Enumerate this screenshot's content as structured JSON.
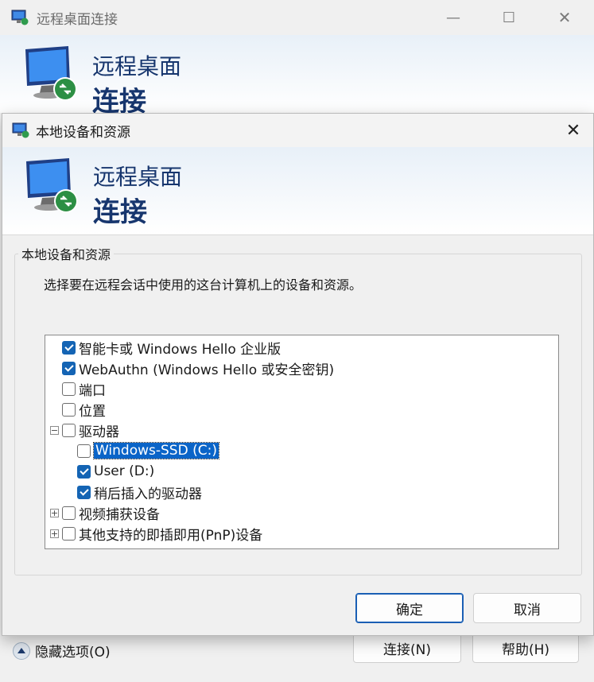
{
  "main_window": {
    "title": "远程桌面连接",
    "minimize_glyph": "—",
    "maximize_glyph": "☐",
    "close_glyph": "✕",
    "banner_line1": "远程桌面",
    "banner_line2": "连接",
    "options_toggle_label": "隐藏选项(O)",
    "connect_label": "连接(N)",
    "help_label": "帮助(H)"
  },
  "dialog": {
    "title": "本地设备和资源",
    "close_glyph": "✕",
    "banner_line1": "远程桌面",
    "banner_line2": "连接",
    "group_title": "本地设备和资源",
    "description": "选择要在远程会话中使用的这台计算机上的设备和资源。",
    "tree": [
      {
        "label": "智能卡或 Windows Hello 企业版",
        "checked": true,
        "level": 0,
        "expander": ""
      },
      {
        "label": "WebAuthn (Windows Hello 或安全密钥)",
        "checked": true,
        "level": 0,
        "expander": ""
      },
      {
        "label": "端口",
        "checked": false,
        "level": 0,
        "expander": ""
      },
      {
        "label": "位置",
        "checked": false,
        "level": 0,
        "expander": ""
      },
      {
        "label": "驱动器",
        "checked": false,
        "level": 0,
        "expander": "−"
      },
      {
        "label": "Windows-SSD (C:)",
        "checked": false,
        "level": 1,
        "expander": "",
        "selected": true
      },
      {
        "label": "User (D:)",
        "checked": true,
        "level": 1,
        "expander": ""
      },
      {
        "label": "稍后插入的驱动器",
        "checked": true,
        "level": 1,
        "expander": ""
      },
      {
        "label": "视频捕获设备",
        "checked": false,
        "level": 0,
        "expander": "+"
      },
      {
        "label": "其他支持的即插即用(PnP)设备",
        "checked": false,
        "level": 0,
        "expander": "+"
      }
    ],
    "ok_label": "确定",
    "cancel_label": "取消"
  },
  "colors": {
    "accent": "#1464b4",
    "banner_text": "#17366e",
    "selection": "#0a64c8"
  }
}
